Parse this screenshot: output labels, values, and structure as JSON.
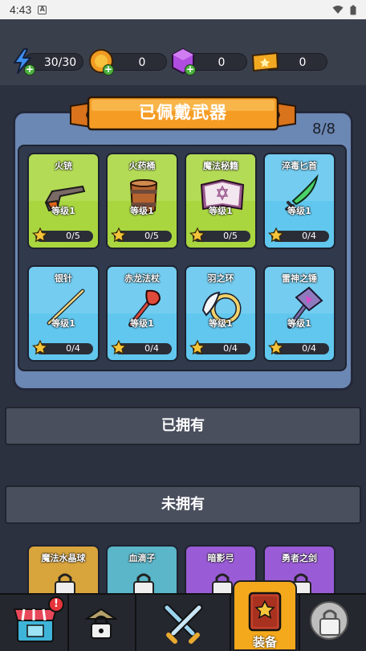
{
  "status_bar": {
    "time": "4:43"
  },
  "currencies": [
    {
      "name": "energy",
      "icon": "lightning-icon",
      "value": "30/30"
    },
    {
      "name": "coin",
      "icon": "coin-icon",
      "value": "0"
    },
    {
      "name": "gem",
      "icon": "gem-icon",
      "value": "0"
    },
    {
      "name": "ticket",
      "icon": "ticket-icon",
      "value": "0"
    }
  ],
  "equipped_panel": {
    "title": "已佩戴武器",
    "count": "8/8",
    "weapons": [
      {
        "name": "火铳",
        "level": "等级1",
        "progress": "0/5",
        "color": "#a9d63f",
        "icon": "flintlock-pistol-icon"
      },
      {
        "name": "火药桶",
        "level": "等级1",
        "progress": "0/5",
        "color": "#a9d63f",
        "icon": "powder-barrel-icon"
      },
      {
        "name": "魔法秘籍",
        "level": "等级1",
        "progress": "0/5",
        "color": "#a9d63f",
        "icon": "spellbook-icon"
      },
      {
        "name": "淬毒匕首",
        "level": "等级1",
        "progress": "0/4",
        "color": "#61c7ee",
        "icon": "poison-dagger-icon"
      },
      {
        "name": "银针",
        "level": "等级1",
        "progress": "0/4",
        "color": "#61c7ee",
        "icon": "silver-needle-icon"
      },
      {
        "name": "赤龙法杖",
        "level": "等级1",
        "progress": "0/4",
        "color": "#61c7ee",
        "icon": "dragon-staff-icon"
      },
      {
        "name": "羽之环",
        "level": "等级1",
        "progress": "0/4",
        "color": "#61c7ee",
        "icon": "feather-ring-icon"
      },
      {
        "name": "雷神之锤",
        "level": "等级1",
        "progress": "0/4",
        "color": "#61c7ee",
        "icon": "thunder-hammer-icon"
      }
    ]
  },
  "owned_section": {
    "label": "已拥有"
  },
  "unowned_section": {
    "label": "未拥有",
    "items": [
      {
        "name": "魔法水晶球",
        "color": "#d8a43c",
        "icon": "crystal-ball-icon"
      },
      {
        "name": "血滴子",
        "color": "#5ab6c8",
        "icon": "blood-drop-icon"
      },
      {
        "name": "暗影弓",
        "color": "#9a5cd6",
        "icon": "shadow-bow-icon"
      },
      {
        "name": "勇者之剑",
        "color": "#9a5cd6",
        "icon": "hero-sword-icon"
      }
    ]
  },
  "bottom_nav": {
    "items": [
      {
        "name": "shop",
        "icon": "shop-icon",
        "badge": "!"
      },
      {
        "name": "locked-1",
        "icon": "lock-icon"
      },
      {
        "name": "battle",
        "icon": "crossed-swords-icon"
      },
      {
        "name": "equipment",
        "icon": "equipment-book-icon",
        "label": "装备",
        "active": true
      },
      {
        "name": "locked-2",
        "icon": "lock-icon"
      }
    ]
  }
}
